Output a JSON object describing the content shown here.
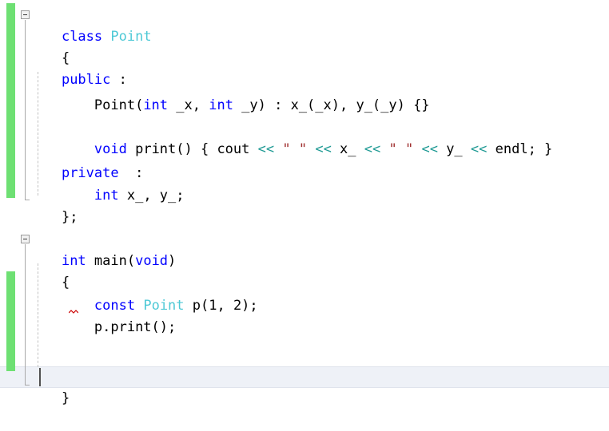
{
  "app": {
    "kind": "code-editor",
    "language": "C++",
    "background": "#ffffff"
  },
  "colors": {
    "keyword": "#0000ff",
    "class_name": "#4ec9d6",
    "operator": "#1f9a94",
    "string": "#a03030",
    "plain_text": "#000000",
    "change_bar": "#6ee073",
    "current_line_highlight": "#eef1f7",
    "indent_guide": "#c2c2c2",
    "fold_line": "#a8a8a8",
    "error_squiggle": "#cc0000",
    "caret": "#505050"
  },
  "gutter": {
    "fold_markers": [
      {
        "name": "fold-marker-class-point",
        "state": "expanded",
        "glyph": "minus"
      },
      {
        "name": "fold-marker-int-main",
        "state": "expanded",
        "glyph": "minus"
      }
    ],
    "change_bars": [
      {
        "name": "change-bar-class-block",
        "label": "modified lines"
      },
      {
        "name": "change-bar-main-block",
        "label": "modified lines"
      }
    ]
  },
  "code": {
    "lines": [
      {
        "id": 1,
        "name": "code-line-class-point",
        "text": "class Point",
        "tokens": [
          {
            "t": "class",
            "c": "keyword"
          },
          {
            "t": " ",
            "c": "plain"
          },
          {
            "t": "Point",
            "c": "class_name"
          }
        ]
      },
      {
        "id": 2,
        "name": "code-line-open-brace-class",
        "text": "{",
        "tokens": [
          {
            "t": "{",
            "c": "plain"
          }
        ]
      },
      {
        "id": 3,
        "name": "code-line-public",
        "text": "public :",
        "tokens": [
          {
            "t": "public",
            "c": "keyword"
          },
          {
            "t": " :",
            "c": "plain"
          }
        ]
      },
      {
        "id": 4,
        "name": "code-line-constructor",
        "text": "    Point(int _x, int _y) : x_(_x), y_(_y) {}",
        "tokens": [
          {
            "t": "    Point(",
            "c": "plain"
          },
          {
            "t": "int",
            "c": "keyword"
          },
          {
            "t": " _x, ",
            "c": "plain"
          },
          {
            "t": "int",
            "c": "keyword"
          },
          {
            "t": " _y) : x_(_x), y_(_y) {}",
            "c": "plain"
          }
        ]
      },
      {
        "id": 5,
        "name": "code-line-blank-1",
        "text": "",
        "tokens": []
      },
      {
        "id": 6,
        "name": "code-line-print-method",
        "text": "    void print() { cout << \" \" << x_ << \" \" << y_ << endl; }",
        "tokens": [
          {
            "t": "    ",
            "c": "plain"
          },
          {
            "t": "void",
            "c": "keyword"
          },
          {
            "t": " print() { cout ",
            "c": "plain"
          },
          {
            "t": "<<",
            "c": "operator"
          },
          {
            "t": " ",
            "c": "plain"
          },
          {
            "t": "\" \"",
            "c": "string"
          },
          {
            "t": " ",
            "c": "plain"
          },
          {
            "t": "<<",
            "c": "operator"
          },
          {
            "t": " x_ ",
            "c": "plain"
          },
          {
            "t": "<<",
            "c": "operator"
          },
          {
            "t": " ",
            "c": "plain"
          },
          {
            "t": "\" \"",
            "c": "string"
          },
          {
            "t": " ",
            "c": "plain"
          },
          {
            "t": "<<",
            "c": "operator"
          },
          {
            "t": " y_ ",
            "c": "plain"
          },
          {
            "t": "<<",
            "c": "operator"
          },
          {
            "t": " endl; }",
            "c": "plain"
          }
        ]
      },
      {
        "id": 7,
        "name": "code-line-private",
        "text": "private :",
        "tokens": [
          {
            "t": "private",
            "c": "keyword"
          },
          {
            "t": "  :",
            "c": "plain"
          }
        ]
      },
      {
        "id": 8,
        "name": "code-line-members",
        "text": "    int x_, y_;",
        "tokens": [
          {
            "t": "    ",
            "c": "plain"
          },
          {
            "t": "int",
            "c": "keyword"
          },
          {
            "t": " x_, y_;",
            "c": "plain"
          }
        ]
      },
      {
        "id": 9,
        "name": "code-line-close-brace-class",
        "text": "};",
        "tokens": [
          {
            "t": "};",
            "c": "plain"
          }
        ]
      },
      {
        "id": 10,
        "name": "code-line-blank-2",
        "text": "",
        "tokens": []
      },
      {
        "id": 11,
        "name": "code-line-int-main",
        "text": "int main(void)",
        "tokens": [
          {
            "t": "int",
            "c": "keyword"
          },
          {
            "t": " main(",
            "c": "plain"
          },
          {
            "t": "void",
            "c": "keyword"
          },
          {
            "t": ")",
            "c": "plain"
          }
        ]
      },
      {
        "id": 12,
        "name": "code-line-open-brace-main",
        "text": "{",
        "tokens": [
          {
            "t": "{",
            "c": "plain"
          }
        ]
      },
      {
        "id": 13,
        "name": "code-line-blank-3",
        "text": "",
        "tokens": []
      },
      {
        "id": 14,
        "name": "code-line-const-point",
        "text": "    const Point p(1, 2);",
        "tokens": [
          {
            "t": "    ",
            "c": "plain"
          },
          {
            "t": "const",
            "c": "keyword"
          },
          {
            "t": " ",
            "c": "plain"
          },
          {
            "t": "Point",
            "c": "class_name"
          },
          {
            "t": " p(1, 2);",
            "c": "plain"
          }
        ]
      },
      {
        "id": 15,
        "name": "code-line-p-print",
        "text": "    p.print();",
        "tokens": [
          {
            "t": "    p.print();",
            "c": "plain"
          }
        ],
        "has_error_squiggle": true
      },
      {
        "id": 16,
        "name": "code-line-blank-4",
        "text": "",
        "tokens": []
      },
      {
        "id": 17,
        "name": "code-line-blank-5",
        "text": "",
        "tokens": []
      },
      {
        "id": 18,
        "name": "code-line-close-brace-main",
        "text": "}",
        "tokens": [
          {
            "t": "}",
            "c": "plain"
          }
        ],
        "is_current_line": true,
        "caret_after": true
      }
    ]
  },
  "caret": {
    "name": "text-caret",
    "line": 18,
    "column": 2
  },
  "diagnostics": [
    {
      "name": "error-squiggle-p-print",
      "line": 15,
      "token": "p",
      "color": "#cc0000"
    }
  ]
}
